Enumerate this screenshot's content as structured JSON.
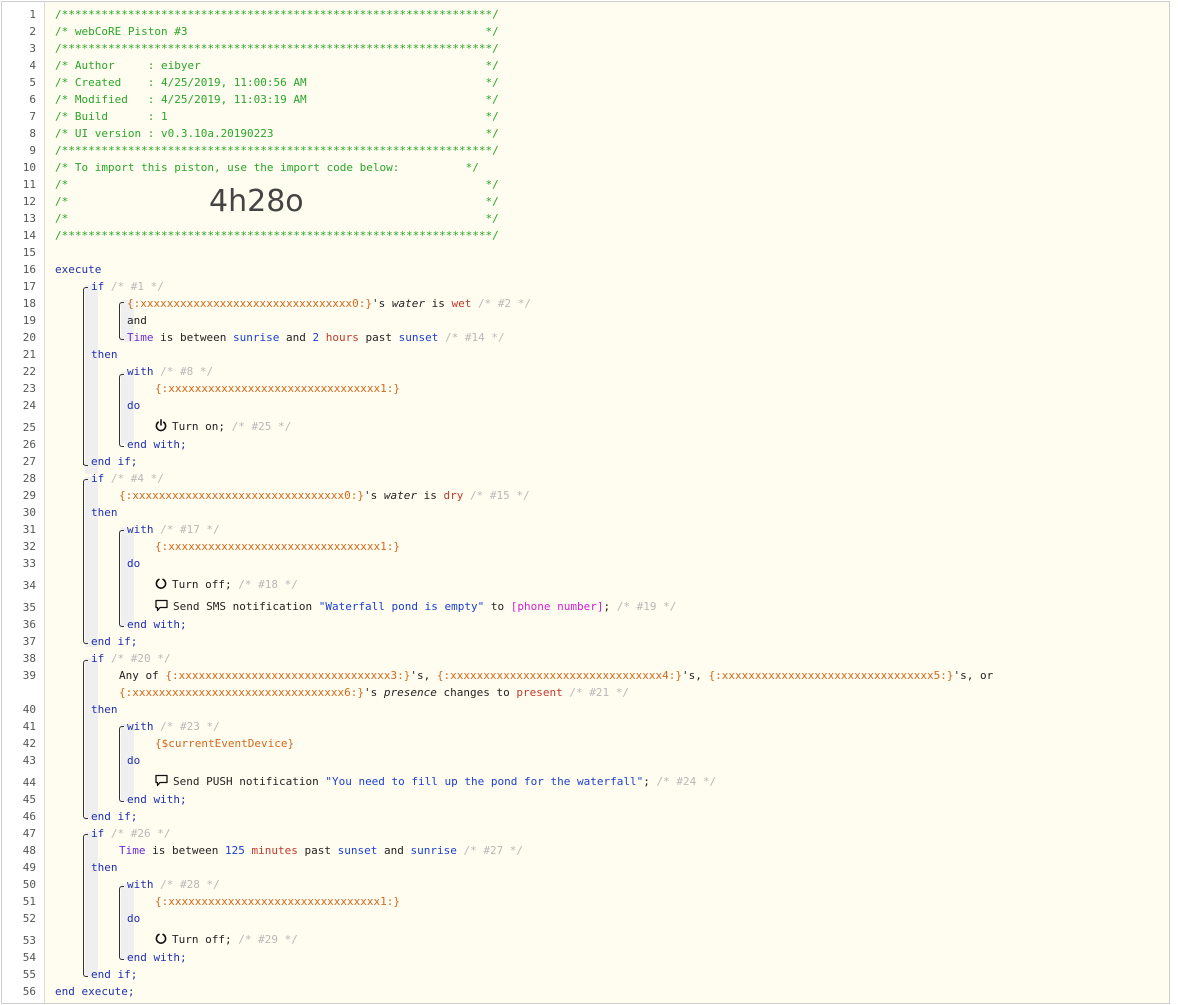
{
  "line_numbers": [
    "1",
    "2",
    "3",
    "4",
    "5",
    "6",
    "7",
    "8",
    "9",
    "10",
    "11",
    "12",
    "13",
    "14",
    "15",
    "16",
    "17",
    "18",
    "19",
    "20",
    "21",
    "22",
    "23",
    "24",
    "25",
    "26",
    "27",
    "28",
    "29",
    "30",
    "31",
    "32",
    "33",
    "34",
    "35",
    "36",
    "37",
    "38",
    "39",
    "40",
    "41",
    "42",
    "43",
    "44",
    "45",
    "46",
    "47",
    "48",
    "49",
    "50",
    "51",
    "52",
    "53",
    "54",
    "55",
    "56"
  ],
  "header": {
    "rule": "/*****************************************************************/",
    "l2": "/* webCoRE Piston #3                                             */",
    "l4": "/* Author     : eibyer                                           */",
    "l5": "/* Created    : 4/25/2019, 11:00:56 AM                           */",
    "l6": "/* Modified   : 4/25/2019, 11:03:19 AM                           */",
    "l7": "/* Build      : 1                                                */",
    "l8": "/* UI version : v0.3.10a.20190223                                */",
    "l10": "/* To import this piston, use the import code below:          */",
    "l11": "/*                                                               */",
    "import_code": "4h28o"
  },
  "kw": {
    "execute": "execute",
    "end_execute": "end execute;",
    "if": "if",
    "then": "then",
    "and": "and",
    "with": "with",
    "do": "do",
    "end_with": "end with;",
    "end_if": "end if;"
  },
  "dev": {
    "d0": "{:xxxxxxxxxxxxxxxxxxxxxxxxxxxxxxxx0:}",
    "d1": "{:xxxxxxxxxxxxxxxxxxxxxxxxxxxxxxxx1:}",
    "d3": "{:xxxxxxxxxxxxxxxxxxxxxxxxxxxxxxxx3:}",
    "d4": "{:xxxxxxxxxxxxxxxxxxxxxxxxxxxxxxxx4:}",
    "d5": "{:xxxxxxxxxxxxxxxxxxxxxxxxxxxxxxxx5:}",
    "d6": "{:xxxxxxxxxxxxxxxxxxxxxxxxxxxxxxxx6:}",
    "current": "{$currentEventDevice}"
  },
  "comments": {
    "c1": "/* #1 */",
    "c2": "/* #2 */",
    "c14": "/* #14 */",
    "c8": "/* #8 */",
    "c25": "/* #25 */",
    "c4": "/* #4 */",
    "c15": "/* #15 */",
    "c17": "/* #17 */",
    "c18": "/* #18 */",
    "c19": "/* #19 */",
    "c20": "/* #20 */",
    "c21": "/* #21 */",
    "c23": "/* #23 */",
    "c24": "/* #24 */",
    "c26": "/* #26 */",
    "c27": "/* #27 */",
    "c28": "/* #28 */",
    "c29": "/* #29 */"
  },
  "tokens": {
    "s_apos": "'s",
    "water": "water",
    "is": "is",
    "wet": "wet",
    "dry": "dry",
    "time": "Time",
    "is_between": "is between",
    "sunrise": "sunrise",
    "and": "and",
    "two": "2",
    "hours": "hours",
    "past": "past",
    "sunset": "sunset",
    "turn_on": "Turn on;",
    "turn_off": "Turn off;",
    "send_sms": "Send SMS notification",
    "sms_msg": "\"Waterfall pond is empty\"",
    "to": "to",
    "phone": "[phone number]",
    "semi": ";",
    "any_of": "Any of",
    "s_comma": "'s,",
    "s_comma_or": "'s, or",
    "presence": "presence",
    "changes_to": "changes to",
    "present": "present",
    "send_push": "Send PUSH notification",
    "push_msg": "\"You need to fill up the pond for the waterfall\"",
    "n125": "125",
    "minutes": "minutes"
  }
}
